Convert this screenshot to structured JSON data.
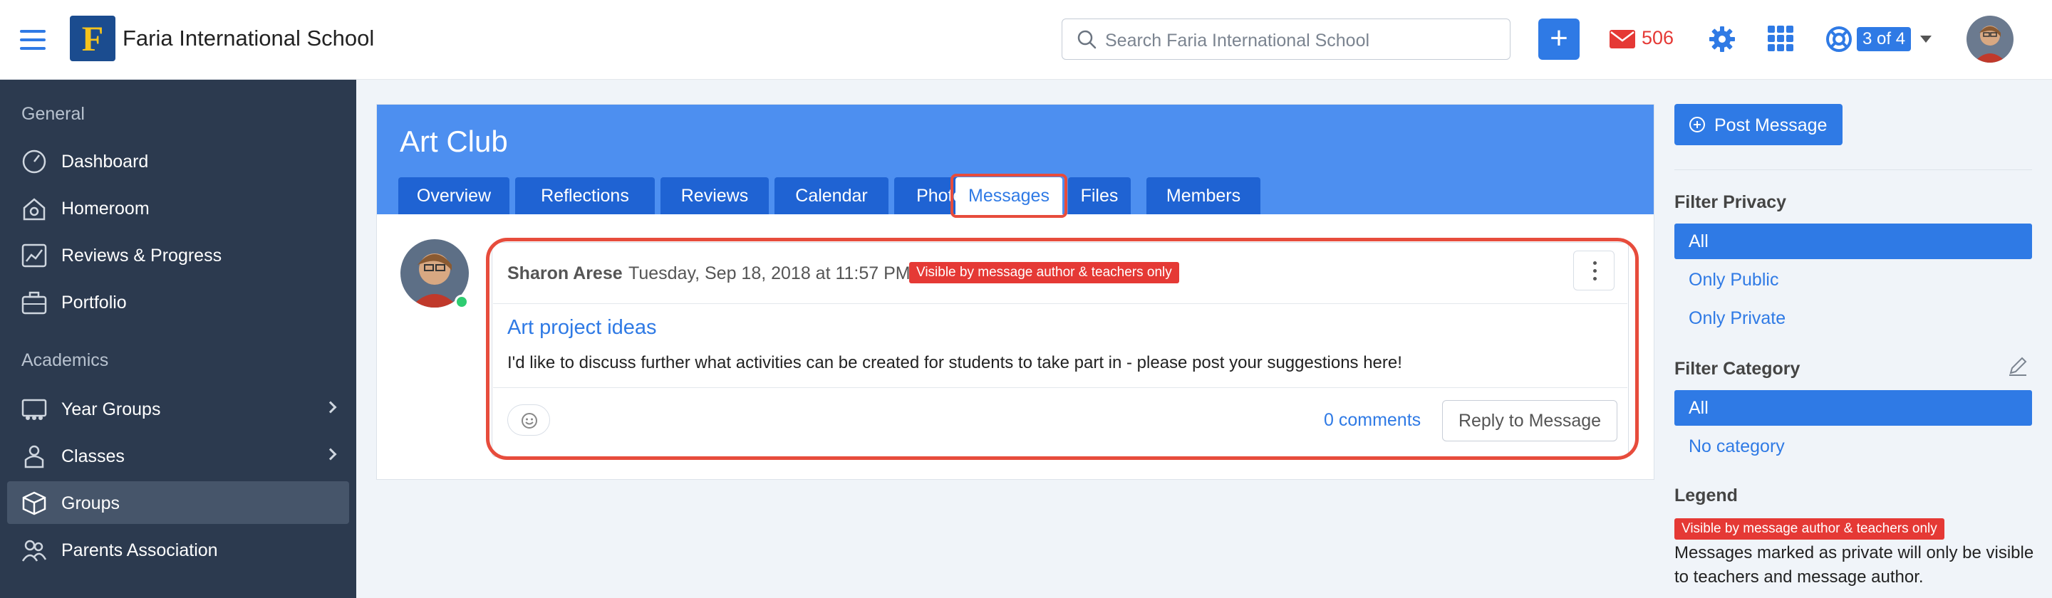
{
  "header": {
    "school_name": "Faria International School",
    "logo_letter": "F",
    "search_placeholder": "Search Faria International School",
    "add_label": "+",
    "mail_count": "506",
    "page_indicator": "3 of 4"
  },
  "sidebar": {
    "sections": [
      {
        "label": "General",
        "items": [
          {
            "label": "Dashboard",
            "icon": "dashboard-icon"
          },
          {
            "label": "Homeroom",
            "icon": "homeroom-icon"
          },
          {
            "label": "Reviews & Progress",
            "icon": "reviews-progress-icon"
          },
          {
            "label": "Portfolio",
            "icon": "portfolio-icon"
          }
        ]
      },
      {
        "label": "Academics",
        "items": [
          {
            "label": "Year Groups",
            "icon": "year-groups-icon",
            "has_submenu": true
          },
          {
            "label": "Classes",
            "icon": "classes-icon",
            "has_submenu": true
          },
          {
            "label": "Groups",
            "icon": "groups-icon",
            "active": true
          },
          {
            "label": "Parents Association",
            "icon": "parents-association-icon"
          }
        ]
      }
    ]
  },
  "group": {
    "title": "Art Club",
    "tabs": [
      "Overview",
      "Reflections",
      "Reviews",
      "Calendar",
      "Photos",
      "Messages",
      "Files",
      "Members"
    ],
    "selected_tab": "Messages"
  },
  "message": {
    "author": "Sharon Arese",
    "date": "Tuesday, Sep 18, 2018 at 11:57 PM",
    "privacy_badge": "Visible by message author & teachers only",
    "title": "Art project ideas",
    "body": "I'd like to discuss further what activities can be created for students to take part in - please post your suggestions here!",
    "comments_label": "0 comments",
    "reply_label": "Reply to Message"
  },
  "right_panel": {
    "post_label": "Post Message",
    "filter_privacy": {
      "heading": "Filter Privacy",
      "options": [
        "All",
        "Only Public",
        "Only Private"
      ],
      "selected": "All"
    },
    "filter_category": {
      "heading": "Filter Category",
      "options": [
        "All",
        "No category"
      ],
      "selected": "All"
    },
    "legend": {
      "heading": "Legend",
      "badge": "Visible by message author & teachers only",
      "text": "Messages marked as private will only be visible to teachers and message author."
    }
  },
  "colors": {
    "accent": "#2f7ae5",
    "sidebar_bg": "#2c3a4f",
    "header_band": "#4d8ff0",
    "tab_bg": "#1f63d3",
    "highlight": "#e74c3c",
    "badge_red": "#e53935",
    "online": "#2ecc71"
  }
}
